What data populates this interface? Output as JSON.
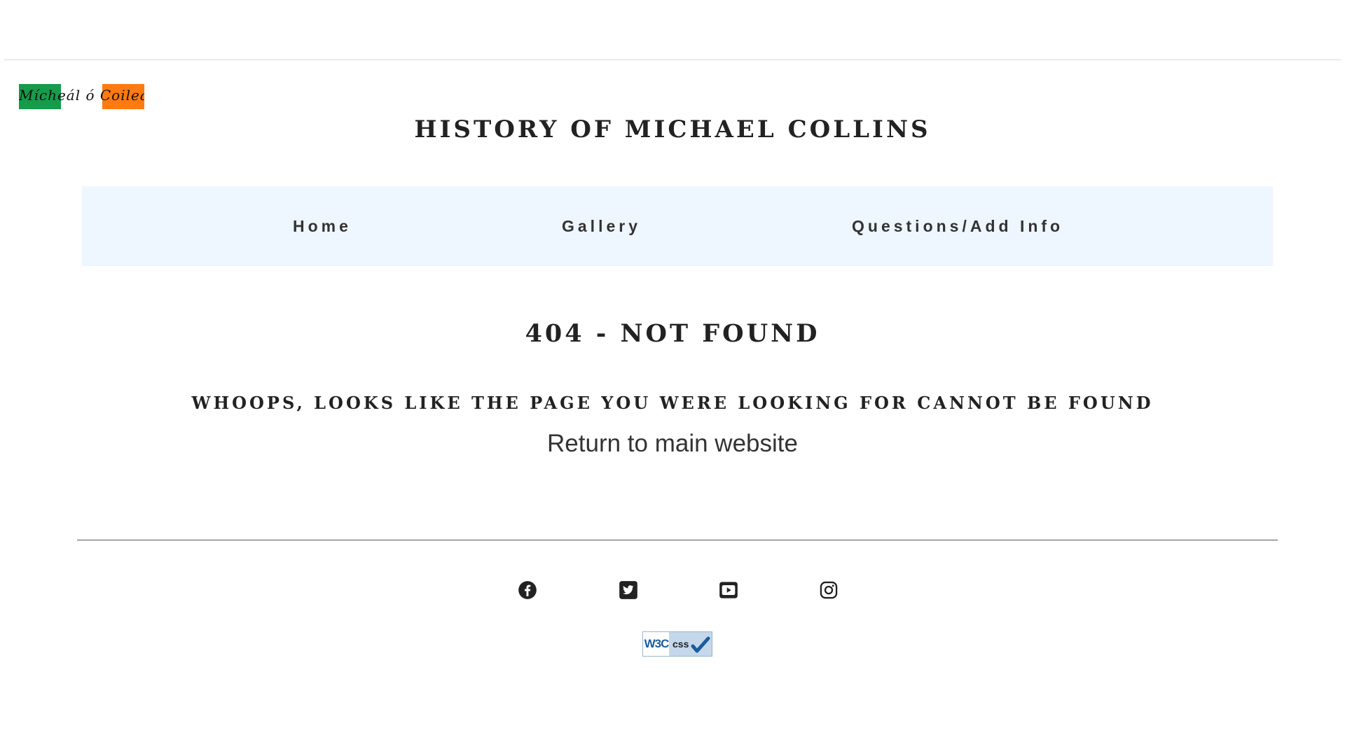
{
  "header": {
    "logo_text": "Mícheál ó Coileáin",
    "title": "HISTORY OF MICHAEL COLLINS",
    "colors": {
      "green": "#169b4b",
      "white": "#ffffff",
      "orange": "#ff7a10"
    }
  },
  "nav": {
    "items": [
      {
        "label": "Home"
      },
      {
        "label": "Gallery"
      },
      {
        "label": "Questions/Add Info"
      }
    ],
    "background": "#eef6ff"
  },
  "main": {
    "heading": "404 - NOT FOUND",
    "subheading": "WHOOPS, LOOKS LIKE THE PAGE YOU WERE LOOKING FOR CANNOT BE FOUND",
    "return_link": "Return to main website"
  },
  "footer": {
    "social_icons": [
      "facebook-icon",
      "twitter-icon",
      "youtube-icon",
      "instagram-icon"
    ],
    "badge": {
      "w3c": "W3C",
      "css": "css"
    }
  }
}
